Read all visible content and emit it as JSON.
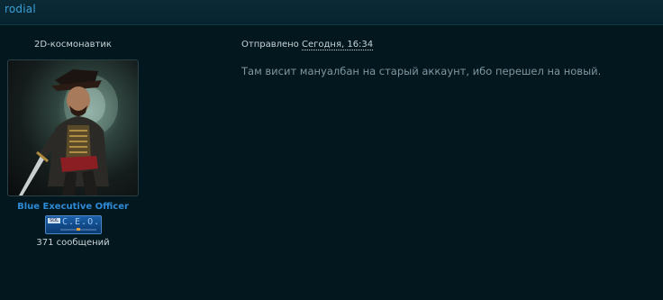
{
  "header": {
    "username": "rodial"
  },
  "author": {
    "custom_title": "2D-космонавтик",
    "rank_name": "Blue Executive Officer",
    "badge_text": "C.E.O.",
    "badge_tag": "SOL",
    "post_count": "371 сообщений"
  },
  "post": {
    "sent_label": "Отправлено",
    "date": "Сегодня, 16:34",
    "body": "Там висит мануалбан на старый аккаунт, ибо перешел на новый."
  },
  "colors": {
    "background": "#041820",
    "link": "#3aa0d8",
    "rank": "#2e8ad6",
    "body_text": "#7e97a2"
  }
}
